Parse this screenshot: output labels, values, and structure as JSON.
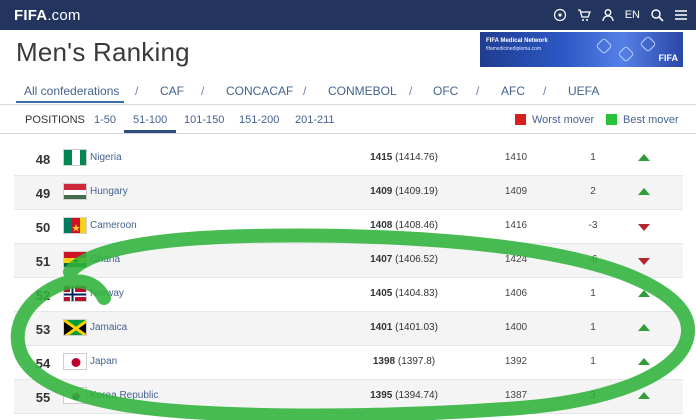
{
  "topbar": {
    "logo_main": "FIFA",
    "logo_suffix": ".com",
    "lang": "EN"
  },
  "page_title": "Men's Ranking",
  "banner": {
    "line1": "FIFA Medical Network",
    "line2": "fifamedicinediploma.com",
    "brand": "FIFA"
  },
  "confederations": [
    "All confederations",
    "CAF",
    "CONCACAF",
    "CONMEBOL",
    "OFC",
    "AFC",
    "UEFA"
  ],
  "positions": {
    "label": "POSITIONS",
    "ranges": [
      "1-50",
      "51-100",
      "101-150",
      "151-200",
      "201-211"
    ],
    "active": "51-100"
  },
  "legend": {
    "worst": "Worst mover",
    "best": "Best mover",
    "worst_color": "#d91e1e",
    "best_color": "#27c23a"
  },
  "rows": [
    {
      "rank": "48",
      "country": "Nigeria",
      "points": "1415",
      "points_exact": "(1414.76)",
      "previous": "1410",
      "change": "1",
      "trend": "up"
    },
    {
      "rank": "49",
      "country": "Hungary",
      "points": "1409",
      "points_exact": "(1409.19)",
      "previous": "1409",
      "change": "2",
      "trend": "up"
    },
    {
      "rank": "50",
      "country": "Cameroon",
      "points": "1408",
      "points_exact": "(1408.46)",
      "previous": "1416",
      "change": "-3",
      "trend": "down"
    },
    {
      "rank": "51",
      "country": "Ghana",
      "points": "1407",
      "points_exact": "(1406.52)",
      "previous": "1424",
      "change": "-6",
      "trend": "down"
    },
    {
      "rank": "52",
      "country": "Norway",
      "points": "1405",
      "points_exact": "(1404.83)",
      "previous": "1406",
      "change": "1",
      "trend": "up"
    },
    {
      "rank": "53",
      "country": "Jamaica",
      "points": "1401",
      "points_exact": "(1401.03)",
      "previous": "1400",
      "change": "1",
      "trend": "up"
    },
    {
      "rank": "54",
      "country": "Japan",
      "points": "1398",
      "points_exact": "(1397.8)",
      "previous": "1392",
      "change": "1",
      "trend": "up"
    },
    {
      "rank": "55",
      "country": "Korea Republic",
      "points": "1395",
      "points_exact": "(1394.74)",
      "previous": "1387",
      "change": "3",
      "trend": "up"
    }
  ],
  "icons": [
    "football-icon",
    "cart-icon",
    "user-icon",
    "search-icon",
    "menu-icon"
  ],
  "annotation_color": "#2fb33a"
}
